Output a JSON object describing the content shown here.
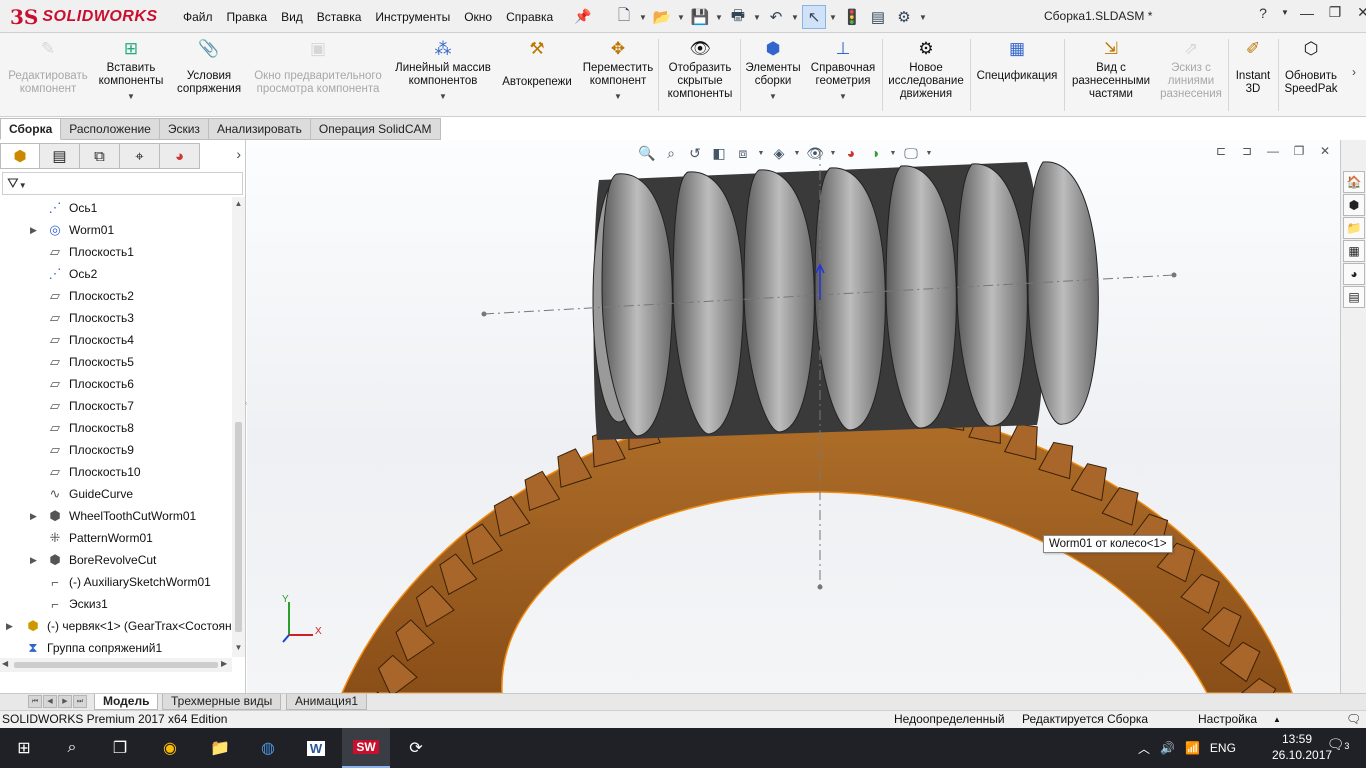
{
  "app": {
    "logo_ds": "3S",
    "logo_text": "SOLIDWORKS",
    "document_title": "Сборка1.SLDASM *"
  },
  "menu": [
    "Файл",
    "Правка",
    "Вид",
    "Вставка",
    "Инструменты",
    "Окно",
    "Справка"
  ],
  "ribbon": {
    "buttons": [
      {
        "label": "Редактировать компонент",
        "disabled": true,
        "icon": "edit-component-icon"
      },
      {
        "label": "Вставить компоненты",
        "disabled": false,
        "icon": "insert-components-icon"
      },
      {
        "label": "Условия сопряжения",
        "disabled": false,
        "icon": "mate-icon"
      },
      {
        "label": "Окно предварительного просмотра компонента",
        "disabled": true,
        "icon": "preview-window-icon"
      },
      {
        "label": "Линейный массив компонентов",
        "disabled": false,
        "icon": "linear-pattern-icon"
      },
      {
        "label": "Автокрепежи",
        "disabled": false,
        "icon": "smart-fasteners-icon"
      },
      {
        "label": "Переместить компонент",
        "disabled": false,
        "icon": "move-component-icon"
      },
      {
        "label": "Отобразить скрытые компоненты",
        "disabled": false,
        "icon": "show-hidden-icon"
      },
      {
        "label": "Элементы сборки",
        "disabled": false,
        "icon": "assembly-features-icon"
      },
      {
        "label": "Справочная геометрия",
        "disabled": false,
        "icon": "reference-geometry-icon"
      },
      {
        "label": "Новое исследование движения",
        "disabled": false,
        "icon": "motion-study-icon"
      },
      {
        "label": "Спецификация",
        "disabled": false,
        "icon": "bom-icon"
      },
      {
        "label": "Вид с разнесенными частями",
        "disabled": false,
        "icon": "exploded-view-icon"
      },
      {
        "label": "Эскиз с линиями разнесения",
        "disabled": true,
        "icon": "explode-line-sketch-icon"
      },
      {
        "label": "Instant 3D",
        "disabled": false,
        "icon": "instant3d-icon"
      },
      {
        "label": "Обновить SpeedPak",
        "disabled": false,
        "icon": "speedpak-icon"
      }
    ]
  },
  "command_tabs": [
    "Сборка",
    "Расположение",
    "Эскиз",
    "Анализировать",
    "Операция SolidCAM"
  ],
  "feature_tree": [
    {
      "label": "Ось1",
      "icon": "axis-icon",
      "expandable": false
    },
    {
      "label": "Worm01",
      "icon": "sketch-part-icon",
      "expandable": true
    },
    {
      "label": "Плоскость1",
      "icon": "plane-icon",
      "expandable": false
    },
    {
      "label": "Ось2",
      "icon": "axis-icon",
      "expandable": false
    },
    {
      "label": "Плоскость2",
      "icon": "plane-icon",
      "expandable": false
    },
    {
      "label": "Плоскость3",
      "icon": "plane-icon",
      "expandable": false
    },
    {
      "label": "Плоскость4",
      "icon": "plane-icon",
      "expandable": false
    },
    {
      "label": "Плоскость5",
      "icon": "plane-icon",
      "expandable": false
    },
    {
      "label": "Плоскость6",
      "icon": "plane-icon",
      "expandable": false
    },
    {
      "label": "Плоскость7",
      "icon": "plane-icon",
      "expandable": false
    },
    {
      "label": "Плоскость8",
      "icon": "plane-icon",
      "expandable": false
    },
    {
      "label": "Плоскость9",
      "icon": "plane-icon",
      "expandable": false
    },
    {
      "label": "Плоскость10",
      "icon": "plane-icon",
      "expandable": false
    },
    {
      "label": "GuideCurve",
      "icon": "curve-icon",
      "expandable": false
    },
    {
      "label": "WheelToothCutWorm01",
      "icon": "cut-feature-icon",
      "expandable": true
    },
    {
      "label": "PatternWorm01",
      "icon": "pattern-icon",
      "expandable": false
    },
    {
      "label": "BoreRevolveCut",
      "icon": "revolve-cut-icon",
      "expandable": true
    },
    {
      "label": "(-) AuxiliarySketchWorm01",
      "icon": "sketch-icon",
      "expandable": false
    },
    {
      "label": "Эскиз1",
      "icon": "sketch-icon",
      "expandable": false
    },
    {
      "label": "(-) червяк<1> (GearTrax<Состоян",
      "icon": "component-icon",
      "expandable": true
    },
    {
      "label": "Группа сопряжений1",
      "icon": "mates-group-icon",
      "expandable": false
    }
  ],
  "viewport": {
    "tooltip": "Worm01 от колесо<1>",
    "triad_x": "X",
    "triad_y": "Y"
  },
  "bottom_tabs": [
    "Модель",
    "Трехмерные виды",
    "Анимация1"
  ],
  "status": {
    "edition": "SOLIDWORKS Premium 2017 x64 Edition",
    "definition": "Недоопределенный",
    "editing": "Редактируется Сборка",
    "custom": "Настройка"
  },
  "taskbar": {
    "lang": "ENG",
    "time": "13:59",
    "date": "26.10.2017",
    "notifications": "3"
  },
  "colors": {
    "brand": "#c8102e",
    "worm": "#7d7d7d",
    "wheel": "#9b5a1c",
    "accent": "#2a6fc9"
  }
}
